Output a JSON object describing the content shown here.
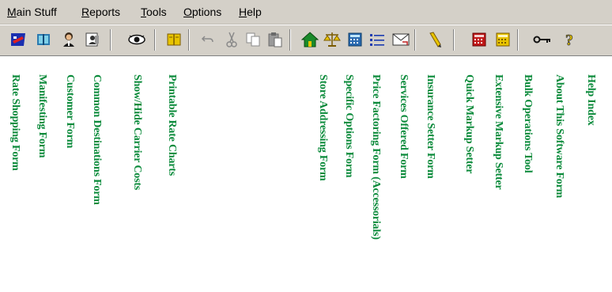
{
  "menu": [
    {
      "id": "main",
      "pre": "",
      "u": "M",
      "post": "ain Stuff"
    },
    {
      "id": "reports",
      "pre": "",
      "u": "R",
      "post": "eports"
    },
    {
      "id": "tools",
      "pre": "",
      "u": "T",
      "post": "ools"
    },
    {
      "id": "options",
      "pre": "",
      "u": "O",
      "post": "ptions"
    },
    {
      "id": "help",
      "pre": "",
      "u": "H",
      "post": "elp"
    }
  ],
  "toolbar": [
    {
      "icon": "flag-icon",
      "label": "Rate Shopping Form"
    },
    {
      "icon": "book-icon",
      "label": "Manifesting Form"
    },
    {
      "icon": "person-icon",
      "label": "Customer Form"
    },
    {
      "icon": "contacts-icon",
      "label": "Common Destinations Form"
    },
    {
      "icon": "eye-icon",
      "label": "Show/Hide Carrier Costs"
    },
    {
      "icon": "open-book-icon",
      "label": "Printable Rate Charts"
    },
    {
      "icon": "undo-icon",
      "label": ""
    },
    {
      "icon": "cut-icon",
      "label": ""
    },
    {
      "icon": "copy-icon",
      "label": ""
    },
    {
      "icon": "paste-icon",
      "label": ""
    },
    {
      "icon": "home-icon",
      "label": "Store Addressing Form"
    },
    {
      "icon": "scales-icon",
      "label": "Specific Options Form"
    },
    {
      "icon": "calculator-icon",
      "label": "Price Factoring Form (Accessorials)"
    },
    {
      "icon": "list-icon",
      "label": "Services Offered Form"
    },
    {
      "icon": "envelope-icon",
      "label": "Insurance Setter Form"
    },
    {
      "icon": "pencil-icon",
      "label": "Quick Markup Setter"
    },
    {
      "icon": "red-calculator-icon",
      "label": "Extensive Markup Setter"
    },
    {
      "icon": "yellow-calculator-icon",
      "label": "Bulk Operations Tool"
    },
    {
      "icon": "key-icon",
      "label": "About This Software Form"
    },
    {
      "icon": "help-icon",
      "label": "Help Index"
    }
  ],
  "colors": {
    "label_green": "#0a8a3a",
    "face": "#d4d0c8"
  }
}
